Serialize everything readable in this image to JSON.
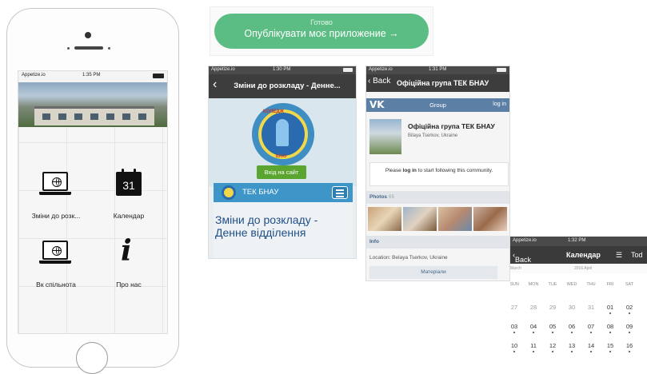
{
  "phone": {
    "status_carrier": "Appetize.io",
    "status_time": "1:35 PM",
    "tiles": [
      {
        "label": "Зміни до розк...",
        "icon": "laptop-globe-icon"
      },
      {
        "label": "Календар",
        "icon": "calendar-icon",
        "icon_text": "31"
      },
      {
        "label": "Вк спільнота",
        "icon": "laptop-globe-icon"
      },
      {
        "label": "Про нас",
        "icon": "info-icon"
      }
    ]
  },
  "publish": {
    "sub_label": "Готово",
    "main_label": "Опублікувати моє приложение →",
    "color": "#5cbd84"
  },
  "screen_schedule": {
    "status_carrier": "Appetize.io",
    "status_time": "1:30 PM",
    "nav_title": "Зміни до розкладу - Денне...",
    "logo_top": "КОЛЕДЖ",
    "logo_bottom": "БНАУ",
    "site_button": "Вхід на сайт",
    "bar_label": "ТЕК БНАУ",
    "heading": "Зміни до розкладу - Денне відділення"
  },
  "screen_vk": {
    "status_carrier": "Appetize.io",
    "status_time": "1:31 PM",
    "back_label": "Back",
    "nav_title": "Офіційна група ТЕК БНАУ",
    "vk_logo": "VK",
    "vk_bar_title": "Group",
    "vk_login": "log in",
    "group_name": "Офіційна група ТЕК БНАУ",
    "group_location": "Bilaya Tserkov, Ukraine",
    "login_prompt_pre": "Please ",
    "login_prompt_link": "log in",
    "login_prompt_post": " to start following this community.",
    "photos_label": "Photos",
    "photos_count": "65",
    "info_label": "Info",
    "location_line": "Location: Belaya Tserkov, Ukraine",
    "materials_button": "Матеріали"
  },
  "screen_calendar": {
    "status_carrier": "Appetize.io",
    "status_time": "1:32 PM",
    "back_label": "Back",
    "nav_title": "Календар",
    "today_label": "Tod",
    "prev_month": "March",
    "current_month": "2016 April",
    "next_month": "",
    "weekdays": [
      "SUN",
      "MON",
      "TUE",
      "WED",
      "THU",
      "FRI",
      "SAT"
    ],
    "weeks": [
      [
        "27",
        "28",
        "29",
        "30",
        "31",
        "01",
        "02"
      ],
      [
        "03",
        "04",
        "05",
        "06",
        "07",
        "08",
        "09"
      ],
      [
        "10",
        "11",
        "12",
        "13",
        "14",
        "15",
        "16"
      ]
    ]
  }
}
